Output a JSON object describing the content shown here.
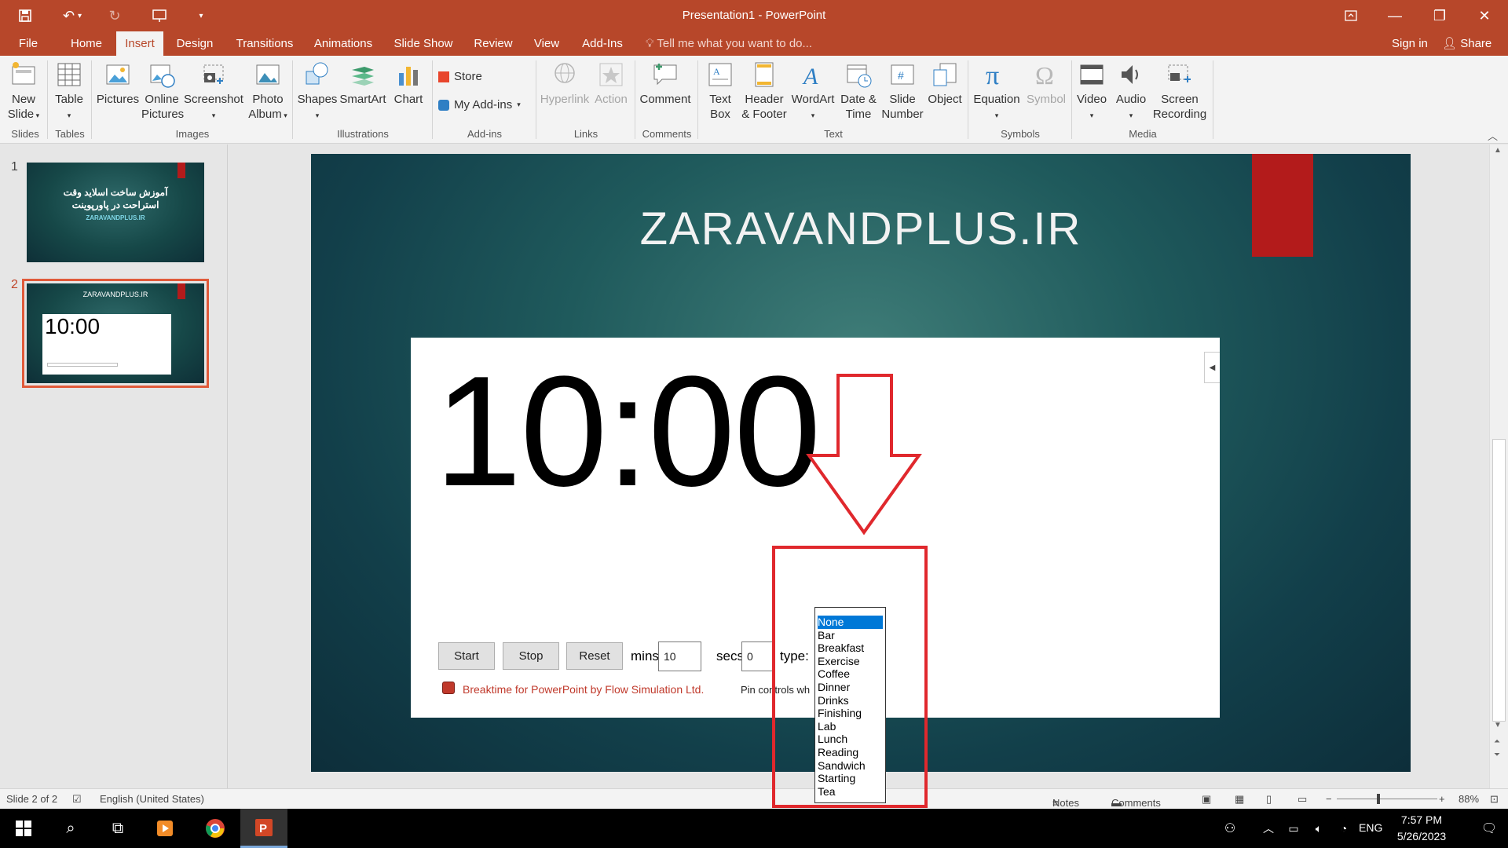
{
  "window": {
    "title": "Presentation1 - PowerPoint"
  },
  "tabs": {
    "file": "File",
    "home": "Home",
    "insert": "Insert",
    "design": "Design",
    "transitions": "Transitions",
    "animations": "Animations",
    "slideshow": "Slide Show",
    "review": "Review",
    "view": "View",
    "addins": "Add-Ins",
    "tellme": "Tell me what you want to do...",
    "signin": "Sign in",
    "share": "Share"
  },
  "ribbon": {
    "new_slide": [
      "New",
      "Slide"
    ],
    "table": "Table",
    "pictures": "Pictures",
    "online_pictures": [
      "Online",
      "Pictures"
    ],
    "screenshot": "Screenshot",
    "photo_album": [
      "Photo",
      "Album"
    ],
    "shapes": "Shapes",
    "smartart": "SmartArt",
    "chart": "Chart",
    "store": "Store",
    "my_addins": "My Add-ins",
    "hyperlink": "Hyperlink",
    "action": "Action",
    "comment": "Comment",
    "text_box": [
      "Text",
      "Box"
    ],
    "header_footer": [
      "Header",
      "& Footer"
    ],
    "wordart": "WordArt",
    "date_time": [
      "Date &",
      "Time"
    ],
    "slide_number": [
      "Slide",
      "Number"
    ],
    "object": "Object",
    "equation": "Equation",
    "symbol": "Symbol",
    "video": "Video",
    "audio": "Audio",
    "screen_recording": [
      "Screen",
      "Recording"
    ],
    "groups": {
      "slides": "Slides",
      "tables": "Tables",
      "images": "Images",
      "illustrations": "Illustrations",
      "addins": "Add-ins",
      "links": "Links",
      "comments": "Comments",
      "text": "Text",
      "symbols": "Symbols",
      "media": "Media"
    }
  },
  "thumbnails": [
    {
      "num": "1",
      "line1": "آموزش ساخت اسلاید وقت",
      "line2": "استراحت در پاورپوینت",
      "line3": "ZARAVANDPLUS.IR"
    },
    {
      "num": "2",
      "title": "ZARAVANDPLUS.IR",
      "timer": "10:00"
    }
  ],
  "slide": {
    "title": "ZARAVANDPLUS.IR",
    "timer": "10:00",
    "start": "Start",
    "stop": "Stop",
    "reset": "Reset",
    "mins_label": "mins:",
    "mins_value": "10",
    "secs_label": "secs:",
    "secs_value": "0",
    "type_label": "type:",
    "credit": "Breaktime for PowerPoint by Flow Simulation Ltd.",
    "pin": "Pin controls wh"
  },
  "type_options": [
    "None",
    "Bar",
    "Breakfast",
    "Exercise",
    "Coffee",
    "Dinner",
    "Drinks",
    "Finishing",
    "Lab",
    "Lunch",
    "Reading",
    "Sandwich",
    "Starting",
    "Tea"
  ],
  "status": {
    "slide": "Slide 2 of 2",
    "language": "English (United States)",
    "notes": "Notes",
    "comments": "Comments",
    "zoom": "88%"
  },
  "taskbar": {
    "lang": "ENG",
    "time": "7:57 PM",
    "date": "5/26/2023"
  },
  "colors": {
    "accent": "#b7472a",
    "annotation": "#e0282d",
    "selection": "#0078d7"
  }
}
